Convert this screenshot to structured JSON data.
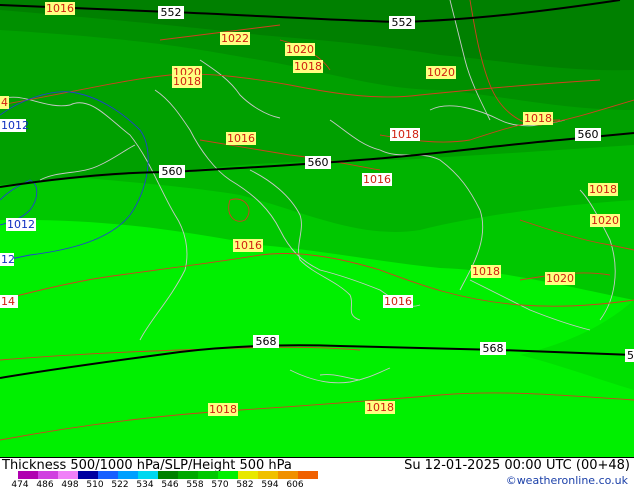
{
  "title": "Thickness 500/1000 hPa/SLP/Height 500 hPa",
  "valid_time": "Su 12-01-2025 00:00 UTC (00+48)",
  "credit": "©weatheronline.co.uk",
  "scale": {
    "colors": [
      "#b000b0",
      "#d040e0",
      "#f080f8",
      "#0000a0",
      "#1860ff",
      "#00a0ff",
      "#00d8f0",
      "#008000",
      "#00a800",
      "#00c800",
      "#00f000",
      "#e8e800",
      "#f0c000",
      "#f09000",
      "#f06000"
    ],
    "ticks": [
      "474",
      "486",
      "498",
      "510",
      "522",
      "534",
      "546",
      "558",
      "570",
      "582",
      "594",
      "606"
    ]
  },
  "height_labels": [
    "552",
    "552",
    "560",
    "560",
    "560",
    "568",
    "568",
    "5"
  ],
  "pressure_labels": {
    "red": [
      "1016",
      "1022",
      "1020",
      "1020",
      "1018",
      "1018",
      "1020",
      "1018",
      "1018",
      "1016",
      "1018",
      "1016",
      "1018",
      "1020",
      "1016",
      "1018",
      "1020",
      "1016",
      "1018",
      "1018",
      "14",
      "4"
    ],
    "blue": [
      "1012",
      "1012",
      "12"
    ]
  },
  "colors": {
    "band_552": "#008000",
    "band_560": "#00a800",
    "band_568": "#00c800",
    "band_576": "#00f000",
    "height_line": "#000000",
    "isobar_red": "#d04020",
    "isobar_blue": "#2040d0",
    "coast": "#c8c8c8"
  }
}
